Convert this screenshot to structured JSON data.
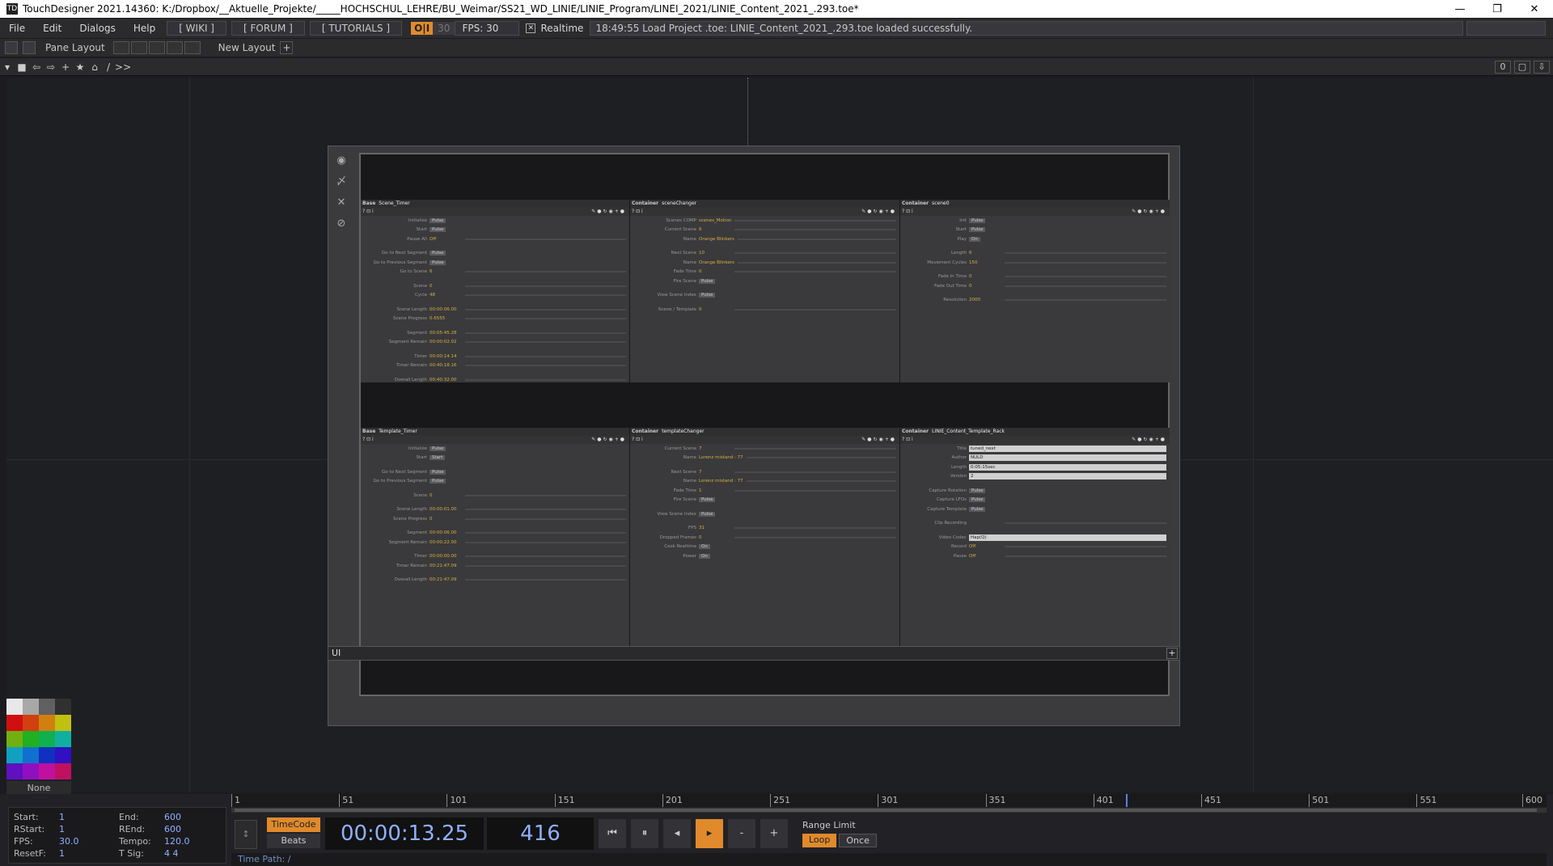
{
  "window": {
    "title": "TouchDesigner 2021.14360: K:/Dropbox/__Aktuelle_Projekte/_____HOCHSCHUL_LEHRE/BU_Weimar/SS21_WD_LINIE/LINIE_Program/LINEI_2021/LINIE_Content_2021_.293.toe*",
    "app_icon": "TD",
    "minimize": "—",
    "restore": "❐",
    "close": "✕"
  },
  "menu": {
    "items": [
      "File",
      "Edit",
      "Dialogs",
      "Help"
    ],
    "wiki": "[ WIKI ]",
    "forum": "[ FORUM ]",
    "tutorials": "[ TUTORIALS ]",
    "oi": "O|I",
    "fps_small": "30",
    "fps_label": "FPS:  30",
    "realtime": "Realtime",
    "status": "18:49:55 Load Project .toe: LINIE_Content_2021_.293.toe loaded successfully."
  },
  "toolbar2": {
    "pane_layout": "Pane Layout",
    "new_layout": "New Layout",
    "plus": "+"
  },
  "pathbar": {
    "icons": [
      "▾",
      "■",
      "⇦",
      "⇨",
      "+",
      "★",
      "⌂"
    ],
    "path": "/",
    "more": ">>",
    "right": [
      "0",
      "▢",
      "⇩"
    ]
  },
  "panel_tools": [
    "◉",
    "〆",
    "✕",
    "⊘"
  ],
  "sections": {
    "scene_timer": {
      "type": "Base",
      "name": "Scene_Timer",
      "rows": [
        {
          "label": "Initialize",
          "btn": "Pulse"
        },
        {
          "label": "Start",
          "btn": "Pulse"
        },
        {
          "label": "Pause All",
          "val": "Off"
        },
        {
          "gap": true
        },
        {
          "label": "Go to Next Segment",
          "btn": "Pulse"
        },
        {
          "label": "Go to Previous Segment",
          "btn": "Pulse"
        },
        {
          "label": "Go to Scene",
          "val": "6"
        },
        {
          "gap": true
        },
        {
          "label": "Scene",
          "val": "0"
        },
        {
          "label": "Cycle",
          "val": "48"
        },
        {
          "gap": true
        },
        {
          "label": "Scene Length",
          "val": "00:00:06.00"
        },
        {
          "label": "Scene Progress",
          "val": "0.6555"
        },
        {
          "gap": true
        },
        {
          "label": "Segment",
          "val": "00:05:45.28"
        },
        {
          "label": "Segment Remain",
          "val": "00:00:02.02"
        },
        {
          "gap": true
        },
        {
          "label": "Timer",
          "val": "00:00:14.14"
        },
        {
          "label": "Timer Remain",
          "val": "00:40:18.16"
        },
        {
          "gap": true
        },
        {
          "label": "Overall Length",
          "val": "00:40:32.00"
        }
      ]
    },
    "scene_changer": {
      "type": "Container",
      "name": "sceneChanger",
      "rows": [
        {
          "label": "Scenes COMP",
          "val": "scenes_Motion"
        },
        {
          "label": "Current Scene",
          "val": "6"
        },
        {
          "label": "Name",
          "val": "Orange Blinkers"
        },
        {
          "gap": true
        },
        {
          "label": "Next Scene",
          "val": "10"
        },
        {
          "label": "Name",
          "val": "Orange Blinkers"
        },
        {
          "label": "Fade Time",
          "val": "0"
        },
        {
          "label": "Fire Scene",
          "btn": "Pulse"
        },
        {
          "gap": true
        },
        {
          "label": "View Scene Index",
          "btn": "Pulse"
        },
        {
          "gap": true
        },
        {
          "label": "Scene / Template",
          "val": "0"
        }
      ]
    },
    "scene0": {
      "type": "Container",
      "name": "scene0",
      "rows": [
        {
          "label": "Init",
          "btn": "Pulse"
        },
        {
          "label": "Start",
          "btn": "Pulse"
        },
        {
          "label": "Play",
          "btn": "On"
        },
        {
          "gap": true
        },
        {
          "label": "Length",
          "val": "6"
        },
        {
          "label": "Movement Cycles",
          "val": "150"
        },
        {
          "gap": true
        },
        {
          "label": "Fade In Time",
          "val": "0"
        },
        {
          "label": "Fade Out Time",
          "val": "0"
        },
        {
          "gap": true
        },
        {
          "label": "Resolution",
          "val": "2000"
        }
      ]
    },
    "template_timer": {
      "type": "Base",
      "name": "Template_Timer",
      "rows": [
        {
          "label": "Initialize",
          "btn": "Pulse"
        },
        {
          "label": "Start",
          "btn": "Start"
        },
        {
          "gap": true
        },
        {
          "label": "Go to Next Segment",
          "btn": "Pulse"
        },
        {
          "label": "Go to Previous Segment",
          "btn": "Pulse"
        },
        {
          "gap": true
        },
        {
          "label": "Scene",
          "val": "0"
        },
        {
          "gap": true
        },
        {
          "label": "Scene Length",
          "val": "00:00:01.00"
        },
        {
          "label": "Scene Progress",
          "val": "0"
        },
        {
          "gap": true
        },
        {
          "label": "Segment",
          "val": "00:00:06.00"
        },
        {
          "label": "Segment Remain",
          "val": "00:00:22.00"
        },
        {
          "gap": true
        },
        {
          "label": "Timer",
          "val": "00:00:00.00"
        },
        {
          "label": "Timer Remain",
          "val": "00:21:47.09"
        },
        {
          "gap": true
        },
        {
          "label": "Overall Length",
          "val": "00:21:47.09"
        }
      ]
    },
    "template_changer": {
      "type": "Container",
      "name": "templateChanger",
      "rows": [
        {
          "label": "Current Scene",
          "val": "7"
        },
        {
          "label": "Name",
          "val": "Lorenz mistand : 77"
        },
        {
          "gap": true
        },
        {
          "label": "Next Scene",
          "val": "7"
        },
        {
          "label": "Name",
          "val": "Lorenz mistand : 77"
        },
        {
          "label": "Fade Time",
          "val": "1"
        },
        {
          "label": "Fire Scene",
          "btn": "Pulse"
        },
        {
          "gap": true
        },
        {
          "label": "View Scene Index",
          "btn": "Pulse"
        },
        {
          "gap": true
        },
        {
          "label": "FPS",
          "val": "31"
        },
        {
          "label": "Dropped Frames",
          "val": "0"
        },
        {
          "label": "Cook Realtime",
          "btn": "On"
        },
        {
          "label": "Power",
          "btn": "On"
        }
      ]
    },
    "template_rack": {
      "type": "Container",
      "name": "LINIE_Content_Template_Rack",
      "rows": [
        {
          "label": "Title",
          "field": "tuned_next"
        },
        {
          "label": "Author",
          "field": "NULD"
        },
        {
          "label": "Length",
          "field": "0:05:15sec"
        },
        {
          "label": "Version",
          "field": "2"
        },
        {
          "gap": true
        },
        {
          "label": "Capture Rotation",
          "btn": "Pulse"
        },
        {
          "label": "Capture LFOs",
          "btn": "Pulse"
        },
        {
          "label": "Capture Template",
          "btn": "Pulse"
        },
        {
          "gap": true
        },
        {
          "label": "Clip Recording",
          "val": ""
        },
        {
          "gap": true
        },
        {
          "label": "Video Codec",
          "field": "Hap(Q)"
        },
        {
          "label": "Record",
          "val": "Off"
        },
        {
          "label": "Pause",
          "val": "Off"
        }
      ]
    }
  },
  "comp_label": "UI",
  "palette": {
    "colors": [
      "#e8e8e8",
      "#a8a8a8",
      "#606060",
      "#303030",
      "#d01010",
      "#d04010",
      "#d08010",
      "#c0c010",
      "#70b010",
      "#20b020",
      "#10b050",
      "#10b0a0",
      "#10a0c0",
      "#1070d0",
      "#1030c0",
      "#3010c0",
      "#6010c0",
      "#9010c0",
      "#c010a0",
      "#c01060"
    ],
    "none": "None"
  },
  "timeline": {
    "ticks": [
      {
        "label": "1",
        "value": 1
      },
      {
        "label": "51",
        "value": 51
      },
      {
        "label": "101",
        "value": 101
      },
      {
        "label": "151",
        "value": 151
      },
      {
        "label": "201",
        "value": 201
      },
      {
        "label": "251",
        "value": 251
      },
      {
        "label": "301",
        "value": 301
      },
      {
        "label": "351",
        "value": 351
      },
      {
        "label": "401",
        "value": 401
      },
      {
        "label": "451",
        "value": 451
      },
      {
        "label": "501",
        "value": 501
      },
      {
        "label": "551",
        "value": 551
      },
      {
        "label": "600",
        "value": 600
      }
    ],
    "current_frame": 416,
    "start": 1,
    "end": 600,
    "info": {
      "start_k": "Start:",
      "start_v": "1",
      "end_k": "End:",
      "end_v": "600",
      "rstart_k": "RStart:",
      "rstart_v": "1",
      "rend_k": "REnd:",
      "rend_v": "600",
      "fps_k": "FPS:",
      "fps_v": "30.0",
      "tempo_k": "Tempo:",
      "tempo_v": "120.0",
      "resetf_k": "ResetF:",
      "resetf_v": "1",
      "tsig_k": "T Sig:",
      "tsig_v": "4    4"
    },
    "timecode_mode": "TimeCode",
    "beats_mode": "Beats",
    "timecode": "00:00:13.25",
    "frame": "416",
    "controls": [
      "⏮",
      "⏸",
      "◂",
      "▸",
      "-",
      "+"
    ],
    "range_limit": "Range Limit",
    "loop": "Loop",
    "once": "Once",
    "time_path": "Time Path: /",
    "stepper": "↕"
  }
}
